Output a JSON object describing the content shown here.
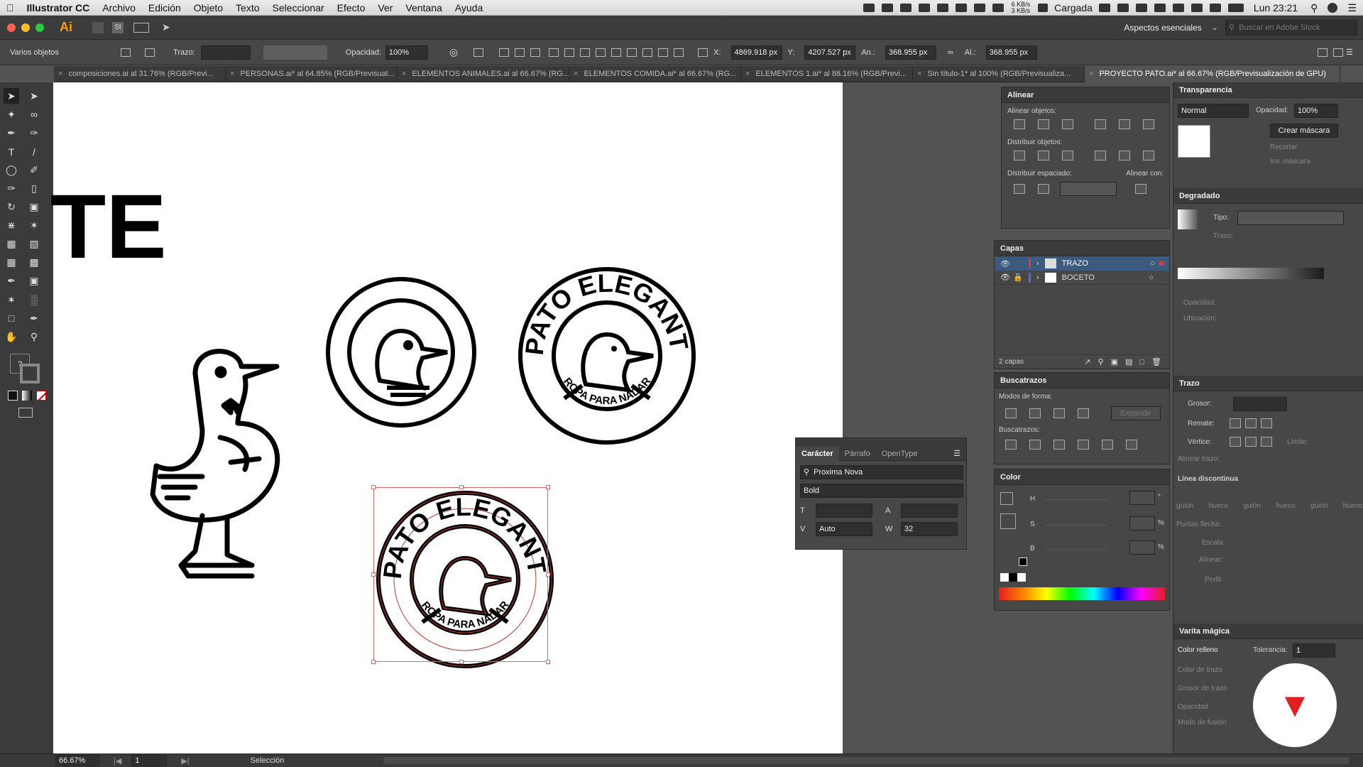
{
  "menubar": {
    "app": "Illustrator CC",
    "items": [
      "Archivo",
      "Edición",
      "Objeto",
      "Texto",
      "Seleccionar",
      "Efecto",
      "Ver",
      "Ventana",
      "Ayuda"
    ],
    "status_right": {
      "net": "6 KB/s\n3 KB/s",
      "battery": "Cargada",
      "clock": "Lun 23:21"
    }
  },
  "appbar": {
    "logo": "Ai",
    "workspace": "Aspectos esenciales",
    "search_placeholder": "Buscar en Adobe Stock",
    "st": "St"
  },
  "control": {
    "selection": "Varios objetos",
    "stroke_label": "Trazo:",
    "opacity_label": "Opacidad:",
    "opacity_value": "100%",
    "x_label": "X:",
    "x_value": "4869.918 px",
    "y_label": "Y:",
    "y_value": "4207.527 px",
    "w_label": "An.:",
    "w_value": "368.955 px",
    "h_label": "Al.:",
    "h_value": "368.955 px"
  },
  "tabs": [
    {
      "label": "composiciones.ai al 31.76% (RGB/Previ..."
    },
    {
      "label": "PERSONAS.ai* al 64.85% (RGB/Previsual..."
    },
    {
      "label": "ELEMENTOS ANIMALES.ai al 66.67% (RG..."
    },
    {
      "label": "ELEMENTOS COMIDA.ai* al 66.67% (RG..."
    },
    {
      "label": "ELEMENTOS 1.ai* al 88.16% (RGB/Previ..."
    },
    {
      "label": "Sin título-1* al 100% (RGB/Previsualiza..."
    },
    {
      "label": "PROYECTO PATO.ai* al 66.67% (RGB/Previsualización de GPU)"
    }
  ],
  "artboard": {
    "partial_title": "TE",
    "logo_top_text": "PATO ELEGANTE",
    "logo_bottom_text": "ROPA PARA NADAR"
  },
  "alinear": {
    "title": "Alinear",
    "align_objects": "Alinear objetos:",
    "distribute_objects": "Distribuir objetos:",
    "distribute_spacing": "Distribuir espaciado:",
    "align_with": "Alinear con:"
  },
  "capas": {
    "title": "Capas",
    "layers": [
      {
        "name": "TRAZO",
        "color": "#e5383b"
      },
      {
        "name": "BOCETO",
        "color": "#4a6fd8"
      }
    ],
    "count": "2 capas"
  },
  "buscatrazos": {
    "title": "Buscatrazos",
    "shape_modes": "Modos de forma:",
    "expand": "Expandir",
    "pathfinders": "Buscatrazos:"
  },
  "color": {
    "title": "Color",
    "labels": [
      "H",
      "S",
      "B"
    ],
    "units": [
      "°",
      "%",
      "%"
    ]
  },
  "caracter": {
    "tabs": [
      "Carácter",
      "Párrafo",
      "OpenType"
    ],
    "font": "Proxima Nova",
    "style": "Bold",
    "tracking": "Auto",
    "kerning": "32"
  },
  "transparencia": {
    "title": "Transparencia",
    "mode": "Normal",
    "opacity_label": "Opacidad:",
    "opacity_value": "100%",
    "make_mask": "Crear máscara",
    "clip": "Recortar",
    "invert": "Inv. máscara"
  },
  "degradado": {
    "title": "Degradado",
    "type_label": "Tipo:",
    "stroke_label": "Trazo:",
    "opacity_label": "Opacidad:",
    "location_label": "Ubicación:"
  },
  "trazo": {
    "title": "Trazo",
    "weight": "Grosor:",
    "cap": "Remate:",
    "corner": "Vértice:",
    "limit": "Límite:",
    "align": "Alinear trazo:",
    "dashed": "Línea discontinua",
    "dash_labels": [
      "guión",
      "hueco",
      "guión",
      "hueco",
      "guión",
      "hueco"
    ],
    "arrowheads": "Puntas flecha:",
    "scale": "Escala:",
    "align2": "Alinear:",
    "profile": "Perfil:"
  },
  "varita": {
    "title": "Varita mágica",
    "fill": "Color relleno",
    "tolerance_label": "Tolerancia:",
    "tolerance": "1",
    "stroke_color": "Color de trazo",
    "stroke_weight": "Grosor de trazo",
    "opacity": "Opacidad",
    "blend": "Modo de fusión"
  },
  "status": {
    "zoom": "66.67%",
    "page": "1",
    "tool": "Selección"
  }
}
